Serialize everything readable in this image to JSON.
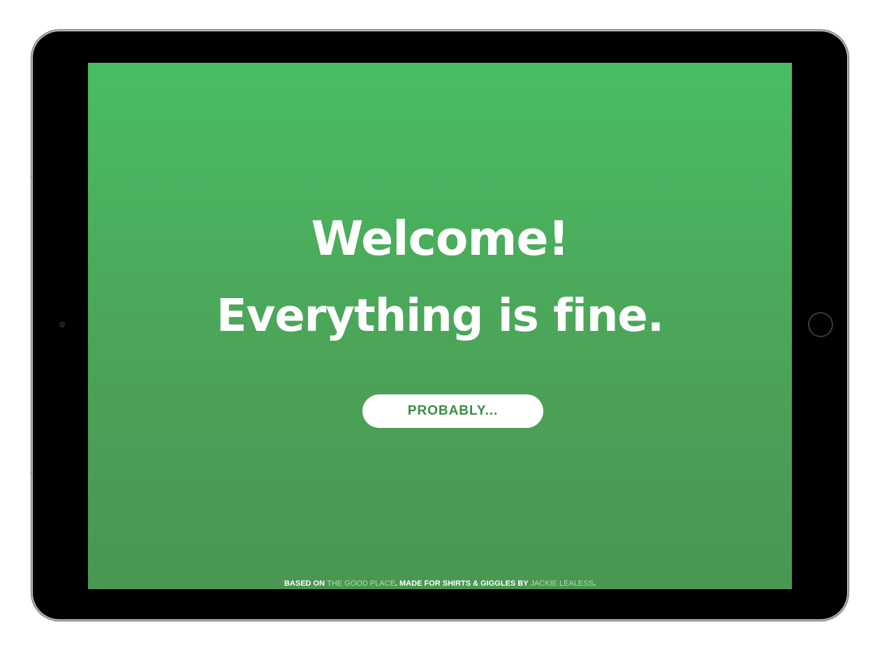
{
  "colors": {
    "screen_top": "#49bd62",
    "screen_bottom": "#4a9652",
    "button_text": "#3a8e47",
    "footer_link": "#a8e0b2"
  },
  "hero": {
    "line1": "Welcome!",
    "line2": "Everything is fine."
  },
  "cta": {
    "label": "PROBABLY..."
  },
  "footer": {
    "prefix": "BASED ON ",
    "show_link": "THE GOOD PLACE",
    "middle": ". MADE FOR SHIRTS & GIGGLES BY ",
    "author_link": "JACKIE LEALESS",
    "suffix": "."
  },
  "device": {
    "camera_icon": "front-camera-icon",
    "home_icon": "home-button-icon"
  }
}
